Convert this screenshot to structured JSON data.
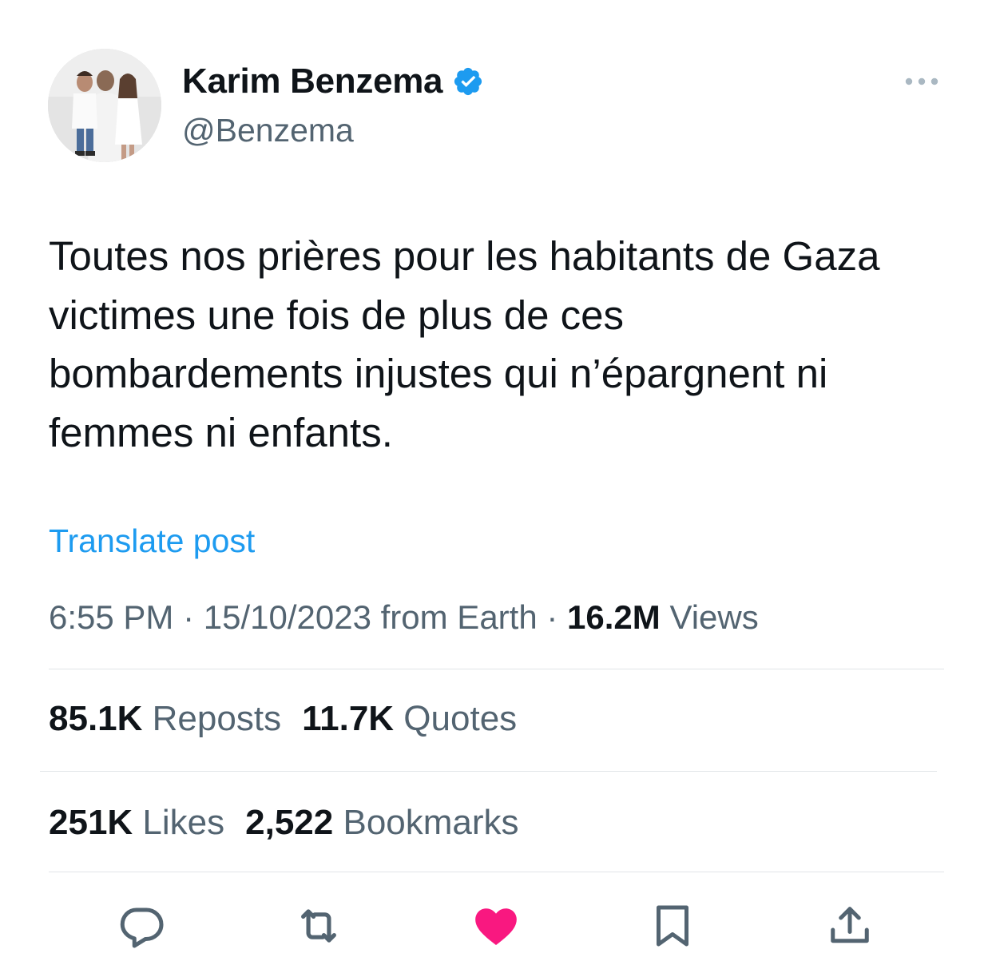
{
  "author": {
    "display_name": "Karim Benzema",
    "handle": "@Benzema",
    "verified_icon": "verified-badge-icon",
    "verified_color": "#1d9bf0"
  },
  "post": {
    "text": "Toutes nos prières pour les habitants de Gaza\nvictimes une fois de plus de ces\nbombardements injustes qui n’épargnent ni\nfemmes ni enfants.",
    "translate_label": "Translate post"
  },
  "meta": {
    "time": "6:55 PM",
    "separator": "·",
    "date_source": "15/10/2023 from Earth",
    "views_count": "16.2M",
    "views_label": "Views"
  },
  "stats": {
    "reposts_count": "85.1K",
    "reposts_label": "Reposts",
    "quotes_count": "11.7K",
    "quotes_label": "Quotes",
    "likes_count": "251K",
    "likes_label": "Likes",
    "bookmarks_count": "2,522",
    "bookmarks_label": "Bookmarks"
  },
  "actions": {
    "icons": [
      "reply-icon",
      "repost-icon",
      "like-icon",
      "bookmark-icon",
      "share-icon"
    ],
    "like_color": "#f91880",
    "icon_color": "#536471"
  }
}
